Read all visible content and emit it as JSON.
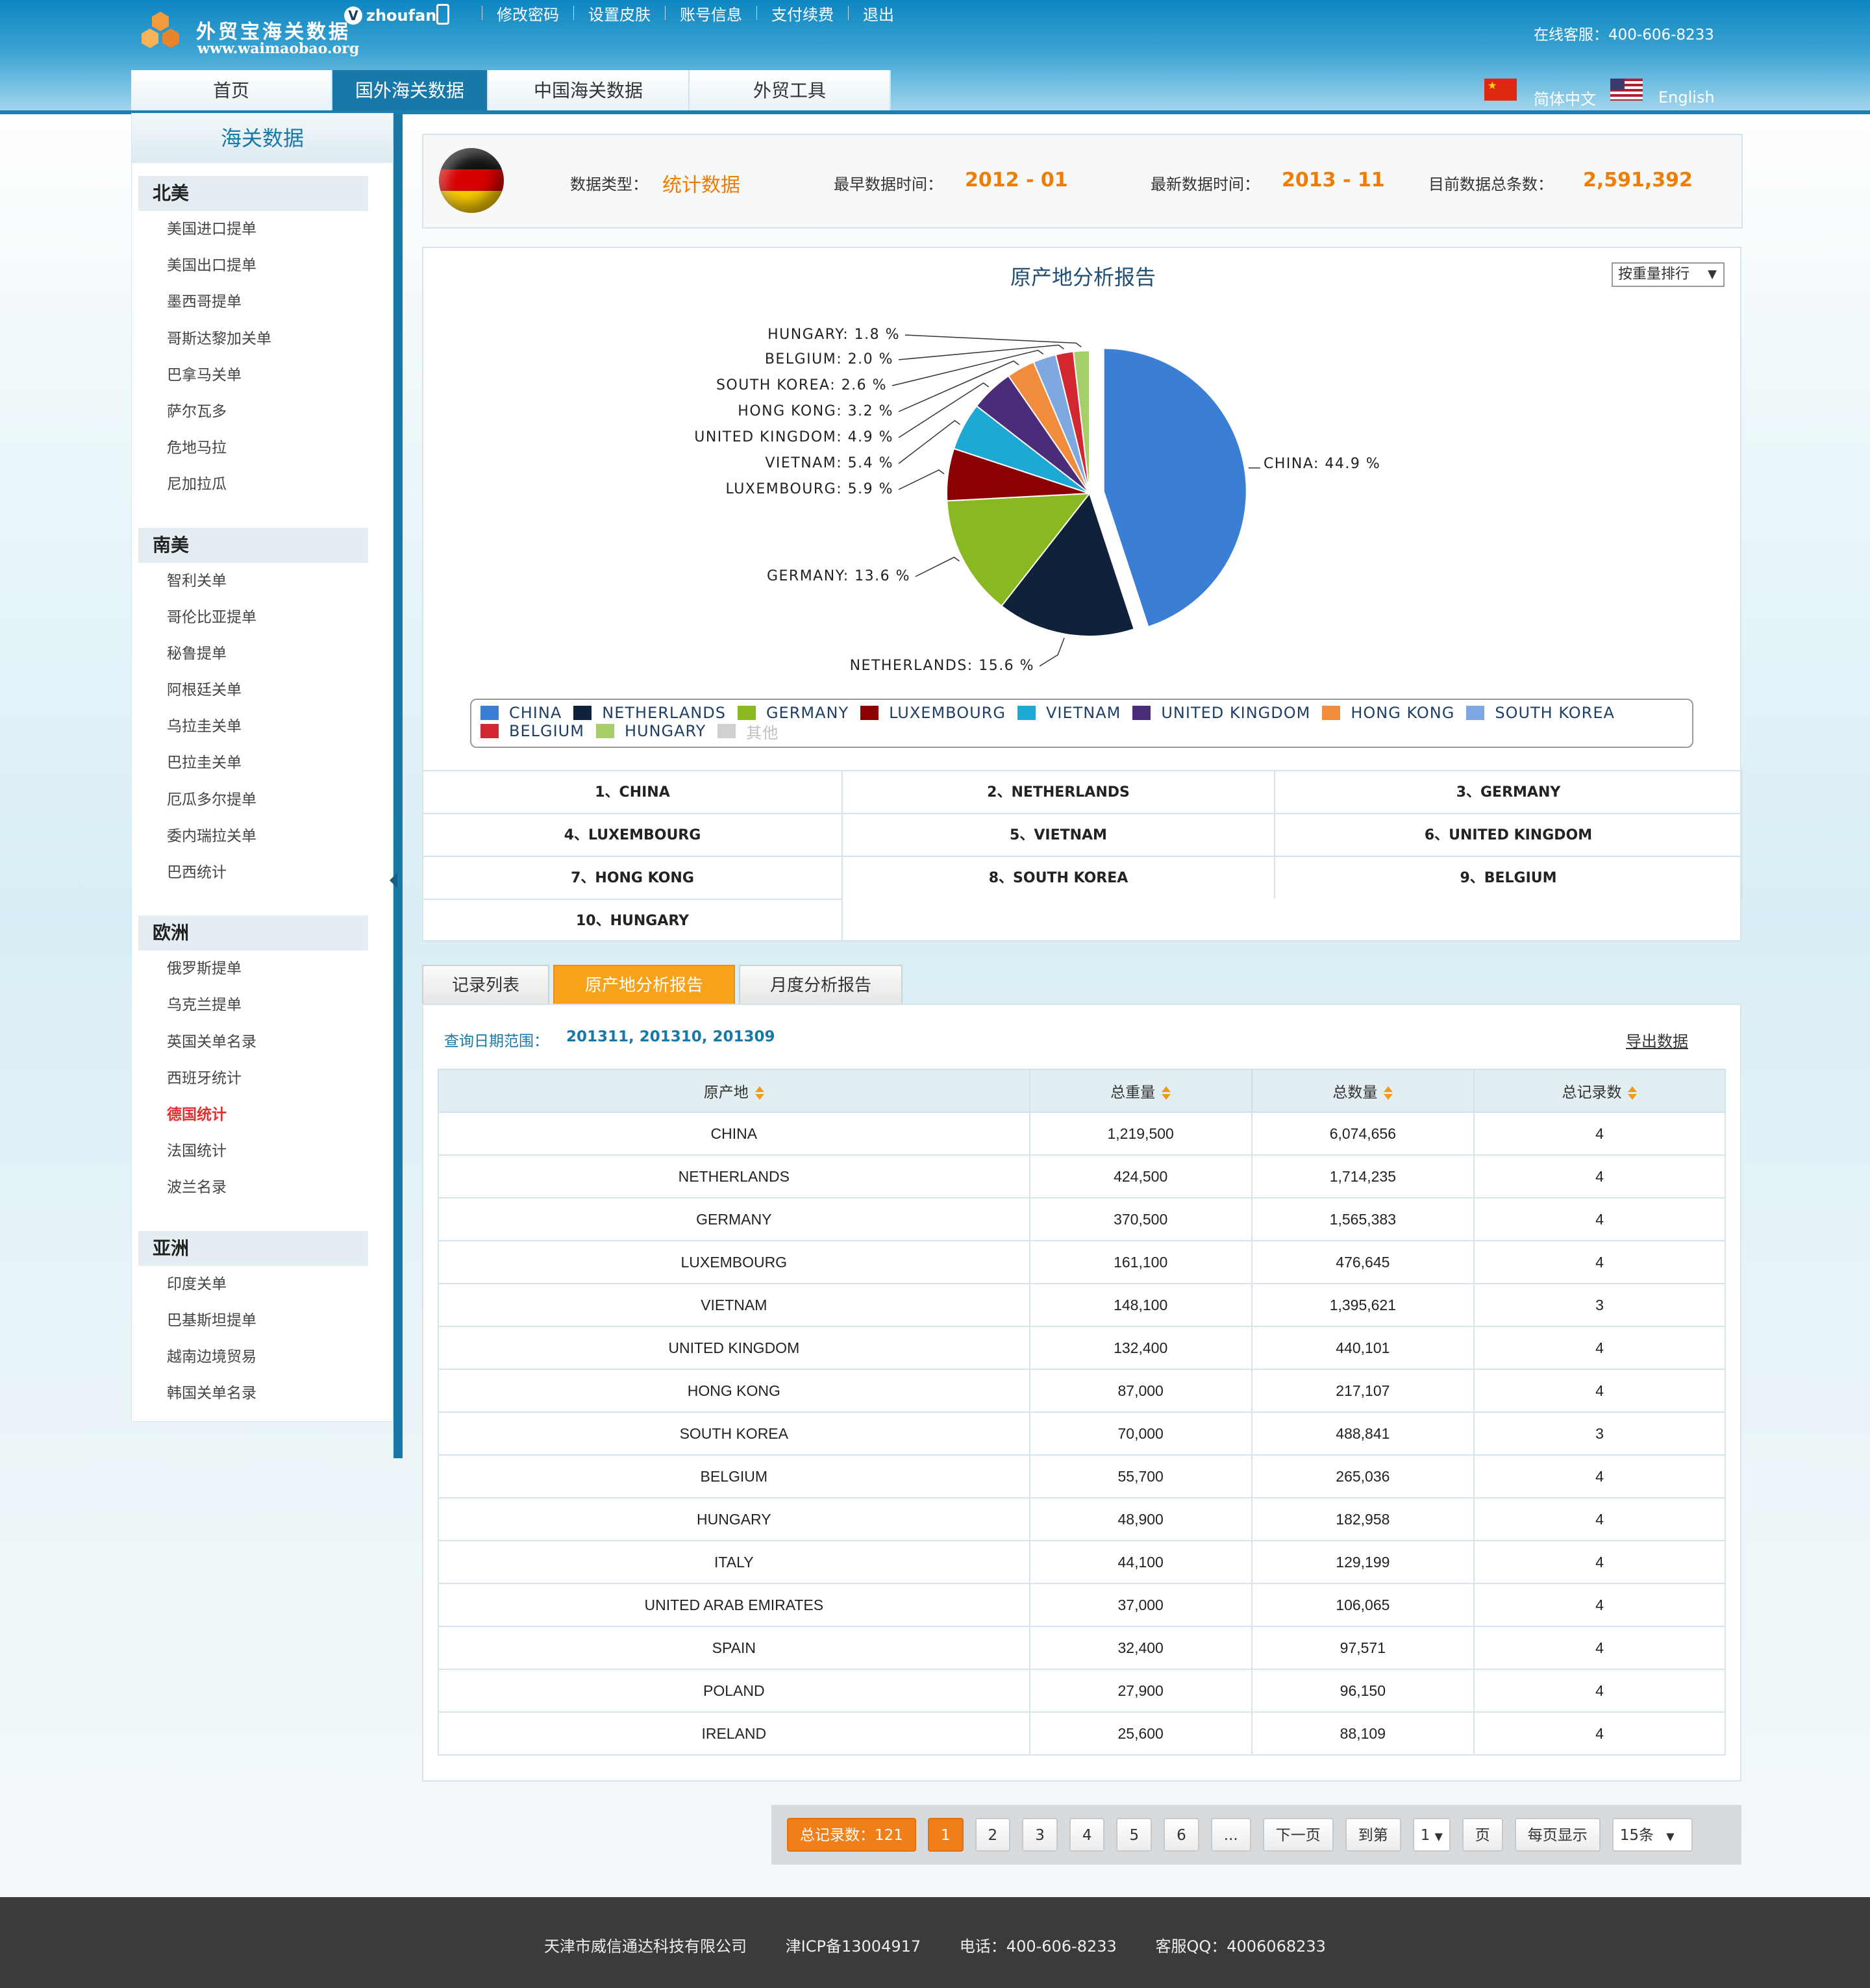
{
  "brand": {
    "title": "外贸宝海关数据",
    "url": "www.waimaobao.org"
  },
  "user": {
    "badge": "V",
    "name": "zhoufan"
  },
  "topnav": [
    "修改密码",
    "设置皮肤",
    "账号信息",
    "支付续费",
    "退出"
  ],
  "service": "在线客服：400-606-8233",
  "mainnav": [
    "首页",
    "国外海关数据",
    "中国海关数据",
    "外贸工具"
  ],
  "lang": {
    "cn": "简体中文",
    "en": "English"
  },
  "sidebar": {
    "title": "海关数据",
    "groups": [
      {
        "name": "北美",
        "items": [
          "美国进口提单",
          "美国出口提单",
          "墨西哥提单",
          "哥斯达黎加关单",
          "巴拿马关单",
          "萨尔瓦多",
          "危地马拉",
          "尼加拉瓜"
        ]
      },
      {
        "name": "南美",
        "items": [
          "智利关单",
          "哥伦比亚提单",
          "秘鲁提单",
          "阿根廷关单",
          "乌拉圭关单",
          "巴拉圭关单",
          "厄瓜多尔提单",
          "委内瑞拉关单",
          "巴西统计"
        ]
      },
      {
        "name": "欧洲",
        "items": [
          "俄罗斯提单",
          "乌克兰提单",
          "英国关单名录",
          "西班牙统计",
          "德国统计",
          "法国统计",
          "波兰名录"
        ]
      },
      {
        "name": "亚洲",
        "items": [
          "印度关单",
          "巴基斯坦提单",
          "越南边境贸易",
          "韩国关单名录"
        ]
      }
    ],
    "active": "德国统计"
  },
  "info": {
    "type_label": "数据类型：",
    "type_value": "统计数据",
    "earliest_label": "最早数据时间：",
    "earliest_value": "2012 - 01",
    "latest_label": "最新数据时间：",
    "latest_value": "2013 - 11",
    "total_label": "目前数据总条数：",
    "total_value": "2,591,392"
  },
  "chart_panel": {
    "title": "原产地分析报告",
    "sort": "按重量排行"
  },
  "chart_data": {
    "type": "pie",
    "title": "原产地分析报告",
    "categories": [
      "CHINA",
      "NETHERLANDS",
      "GERMANY",
      "LUXEMBOURG",
      "VIETNAM",
      "UNITED KINGDOM",
      "HONG KONG",
      "SOUTH KOREA",
      "BELGIUM",
      "HUNGARY"
    ],
    "values": [
      44.9,
      15.6,
      13.6,
      5.9,
      5.4,
      4.9,
      3.2,
      2.6,
      2.0,
      1.8
    ],
    "colors": [
      "#3a7fd5",
      "#10223a",
      "#8ab820",
      "#8b0000",
      "#1ea8d4",
      "#4a2c78",
      "#f08c3c",
      "#7fa7e0",
      "#d22630",
      "#a6cf6a"
    ],
    "labels": [
      "CHINA: 44.9 %",
      "NETHERLANDS: 15.6 %",
      "GERMANY: 13.6 %",
      "LUXEMBOURG: 5.9 %",
      "VIETNAM: 5.4 %",
      "UNITED KINGDOM: 4.9 %",
      "HONG KONG: 3.2 %",
      "SOUTH KOREA: 2.6 %",
      "BELGIUM: 2.0 %",
      "HUNGARY: 1.8 %"
    ],
    "legend": [
      "CHINA",
      "NETHERLANDS",
      "GERMANY",
      "LUXEMBOURG",
      "VIETNAM",
      "UNITED KINGDOM",
      "HONG KONG",
      "SOUTH KOREA",
      "BELGIUM",
      "HUNGARY",
      "其他"
    ],
    "legend_other_color": "#d0d0d0"
  },
  "ranking": [
    "1、CHINA",
    "2、NETHERLANDS",
    "3、GERMANY",
    "4、LUXEMBOURG",
    "5、VIETNAM",
    "6、UNITED KINGDOM",
    "7、HONG KONG",
    "8、SOUTH KOREA",
    "9、BELGIUM",
    "10、HUNGARY"
  ],
  "tabs": [
    "记录列表",
    "原产地分析报告",
    "月度分析报告"
  ],
  "query": {
    "label": "查询日期范围：",
    "value": "201311, 201310, 201309",
    "export": "导出数据"
  },
  "table": {
    "columns": [
      "原产地",
      "总重量",
      "总数量",
      "总记录数"
    ],
    "rows": [
      [
        "CHINA",
        "1,219,500",
        "6,074,656",
        "4"
      ],
      [
        "NETHERLANDS",
        "424,500",
        "1,714,235",
        "4"
      ],
      [
        "GERMANY",
        "370,500",
        "1,565,383",
        "4"
      ],
      [
        "LUXEMBOURG",
        "161,100",
        "476,645",
        "4"
      ],
      [
        "VIETNAM",
        "148,100",
        "1,395,621",
        "3"
      ],
      [
        "UNITED KINGDOM",
        "132,400",
        "440,101",
        "4"
      ],
      [
        "HONG KONG",
        "87,000",
        "217,107",
        "4"
      ],
      [
        "SOUTH KOREA",
        "70,000",
        "488,841",
        "3"
      ],
      [
        "BELGIUM",
        "55,700",
        "265,036",
        "4"
      ],
      [
        "HUNGARY",
        "48,900",
        "182,958",
        "4"
      ],
      [
        "ITALY",
        "44,100",
        "129,199",
        "4"
      ],
      [
        "UNITED ARAB EMIRATES",
        "37,000",
        "106,065",
        "4"
      ],
      [
        "SPAIN",
        "32,400",
        "97,571",
        "4"
      ],
      [
        "POLAND",
        "27,900",
        "96,150",
        "4"
      ],
      [
        "IRELAND",
        "25,600",
        "88,109",
        "4"
      ]
    ]
  },
  "pager": {
    "total": "总记录数：121",
    "pages": [
      "1",
      "2",
      "3",
      "4",
      "5",
      "6",
      "..."
    ],
    "next": "下一页",
    "goto": "到第",
    "goto_value": "1",
    "page_unit": "页",
    "per_page_label": "每页显示",
    "per_page_value": "15条"
  },
  "footer": {
    "company": "天津市威信通达科技有限公司",
    "icp": "津ICP备13004917",
    "phone": "电话：400-606-8233",
    "qq": "客服QQ：4006068233"
  }
}
